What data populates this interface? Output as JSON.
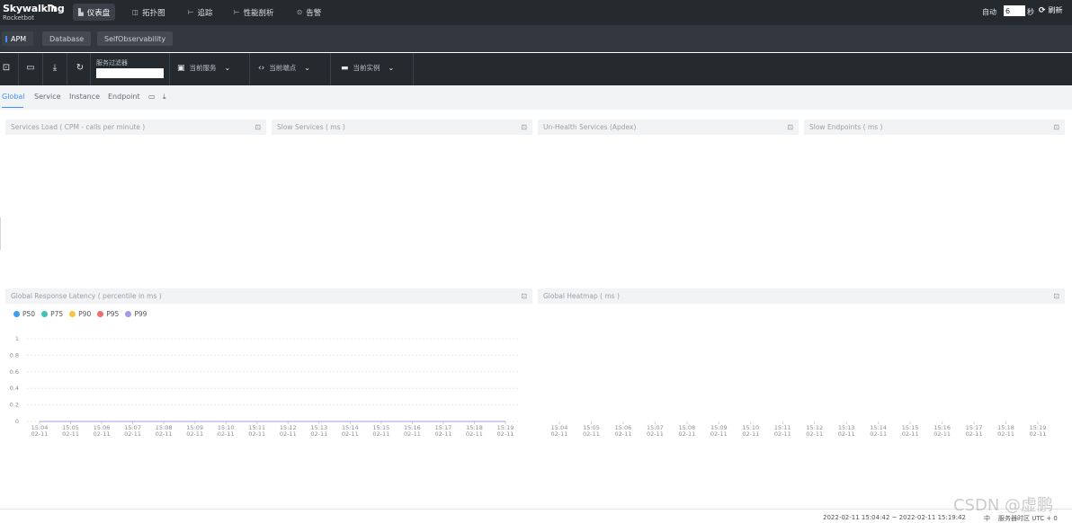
{
  "brand": {
    "name": "Skywalking",
    "sub": "Rocketbot"
  },
  "nav": [
    {
      "icon": "▙",
      "label": "仪表盘"
    },
    {
      "icon": "◫",
      "label": "拓扑图"
    },
    {
      "icon": "⊢",
      "label": "追踪"
    },
    {
      "icon": "⊢",
      "label": "性能剖析"
    },
    {
      "icon": "⊙",
      "label": "告警"
    }
  ],
  "auto": {
    "label": "自动",
    "value": "6",
    "unit": "秒",
    "refresh": "刷新"
  },
  "layers": [
    "APM",
    "Database",
    "SelfObservability"
  ],
  "toolbar": {
    "filter_label": "服务过滤器",
    "service": "当前服务",
    "endpoint": "当前端点",
    "instance": "当前实例"
  },
  "tabs": [
    "Global",
    "Service",
    "Instance",
    "Endpoint"
  ],
  "panels": {
    "services_load": "Services Load ( CPM - calls per minute )",
    "slow_services": "Slow Services ( ms )",
    "unhealth": "Un-Health Services (Apdex)",
    "slow_endpoints": "Slow Endpoints ( ms )",
    "latency": "Global Response Latency ( percentile in ms )",
    "heatmap": "Global Heatmap ( ms )"
  },
  "legend": [
    {
      "name": "P50",
      "color": "#3f9ff0"
    },
    {
      "name": "P75",
      "color": "#3fc2b8"
    },
    {
      "name": "P90",
      "color": "#f5c543"
    },
    {
      "name": "P95",
      "color": "#f26c6f"
    },
    {
      "name": "P99",
      "color": "#a39bea"
    }
  ],
  "chart_data": [
    {
      "type": "line",
      "title": "Global Response Latency ( percentile in ms )",
      "categories": [
        "15:04\n02-11",
        "15:05\n02-11",
        "15:06\n02-11",
        "15:07\n02-11",
        "15:08\n02-11",
        "15:09\n02-11",
        "15:10\n02-11",
        "15:11\n02-11",
        "15:12\n02-11",
        "15:13\n02-11",
        "15:14\n02-11",
        "15:15\n02-11",
        "15:16\n02-11",
        "15:17\n02-11",
        "15:18\n02-11",
        "15:19\n02-11"
      ],
      "yticks": [
        "0",
        "0.2",
        "0.4",
        "0.6",
        "0.8",
        "1"
      ],
      "ylim": [
        0,
        1
      ],
      "series": [
        {
          "name": "P50",
          "values": [
            0,
            0,
            0,
            0,
            0,
            0,
            0,
            0,
            0,
            0,
            0,
            0,
            0,
            0,
            0,
            0
          ]
        },
        {
          "name": "P75",
          "values": [
            0,
            0,
            0,
            0,
            0,
            0,
            0,
            0,
            0,
            0,
            0,
            0,
            0,
            0,
            0,
            0
          ]
        },
        {
          "name": "P90",
          "values": [
            0,
            0,
            0,
            0,
            0,
            0,
            0,
            0,
            0,
            0,
            0,
            0,
            0,
            0,
            0,
            0
          ]
        },
        {
          "name": "P95",
          "values": [
            0,
            0,
            0,
            0,
            0,
            0,
            0,
            0,
            0,
            0,
            0,
            0,
            0,
            0,
            0,
            0
          ]
        },
        {
          "name": "P99",
          "values": [
            0,
            0,
            0,
            0,
            0,
            0,
            0,
            0,
            0,
            0,
            0,
            0,
            0,
            0,
            0,
            0
          ]
        }
      ],
      "grid": true,
      "legend": "top-left"
    },
    {
      "type": "heatmap",
      "title": "Global Heatmap ( ms )",
      "categories": [
        "15:04\n02-11",
        "15:05\n02-11",
        "15:06\n02-11",
        "15:07\n02-11",
        "15:08\n02-11",
        "15:09\n02-11",
        "15:10\n02-11",
        "15:11\n02-11",
        "15:12\n02-11",
        "15:13\n02-11",
        "15:14\n02-11",
        "15:15\n02-11",
        "15:16\n02-11",
        "15:17\n02-11",
        "15:18\n02-11",
        "15:19\n02-11"
      ],
      "values": []
    }
  ],
  "footer": {
    "time_range": "2022-02-11 15:04:42 ~ 2022-02-11 15:19:42",
    "lang": "中",
    "timezone": "服务器时区 UTC + 0"
  },
  "watermark": "CSDN @虚鹏"
}
